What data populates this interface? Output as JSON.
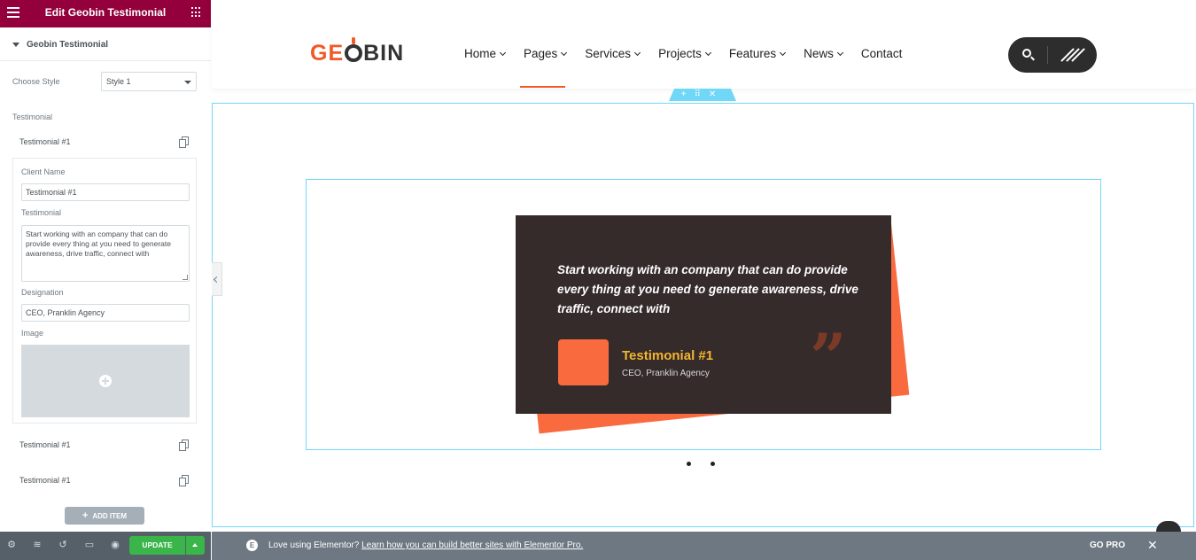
{
  "editor": {
    "header_title": "Edit Geobin Testimonial",
    "section_title": "Geobin Testimonial",
    "choose_style_label": "Choose Style",
    "choose_style_value": "Style 1",
    "repeater_label": "Testimonial",
    "items": [
      {
        "title": "Testimonial #1"
      },
      {
        "title": "Testimonial #1"
      },
      {
        "title": "Testimonial #1"
      }
    ],
    "expanded_item": {
      "client_name_label": "Client Name",
      "client_name_value": "Testimonial #1",
      "testimonial_label": "Testimonial",
      "testimonial_value": "Start working with an company that can do provide every thing at you need to generate awareness, drive traffic, connect with",
      "designation_label": "Designation",
      "designation_value": "CEO, Pranklin Agency",
      "image_label": "Image"
    },
    "add_item_label": "ADD ITEM",
    "footer": {
      "update_label": "UPDATE"
    }
  },
  "site": {
    "logo": {
      "part1": "GE",
      "part2": "BIN"
    },
    "nav": [
      {
        "label": "Home",
        "has_dropdown": true
      },
      {
        "label": "Pages",
        "has_dropdown": true,
        "active": true
      },
      {
        "label": "Services",
        "has_dropdown": true
      },
      {
        "label": "Projects",
        "has_dropdown": true
      },
      {
        "label": "Features",
        "has_dropdown": true
      },
      {
        "label": "News",
        "has_dropdown": true
      },
      {
        "label": "Contact",
        "has_dropdown": false
      }
    ],
    "section_handle": {
      "add": "+",
      "move": "⠿",
      "close": "✕"
    },
    "testimonial": {
      "text": "Start working with an company that can do provide every thing at you need to generate awareness, drive traffic, connect with",
      "client_name": "Testimonial #1",
      "designation": "CEO, Pranklin Agency"
    },
    "carousel_dots": 2
  },
  "promo": {
    "icon_letter": "E",
    "text": "Love using Elementor?",
    "link_text": "Learn how you can build better sites with Elementor Pro.",
    "gopro_label": "GO PRO",
    "close_glyph": "✕"
  },
  "colors": {
    "panel_header": "#93003c",
    "accent": "#f05a28",
    "card_bg": "#352b2b",
    "card_accent": "#f96a3f",
    "name_color": "#f5b52e",
    "update_green": "#39b54a",
    "outline": "#71d7f7"
  }
}
